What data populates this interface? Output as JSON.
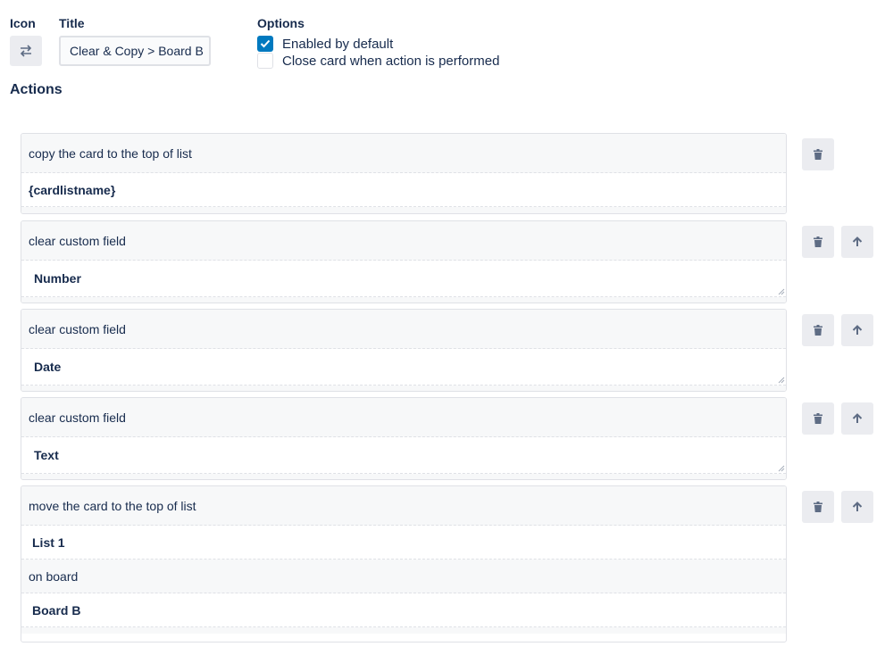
{
  "header": {
    "icon_label": "Icon",
    "title_label": "Title",
    "options_label": "Options",
    "title_value": "Clear & Copy > Board B",
    "icon_name": "swap-arrows-icon"
  },
  "options": [
    {
      "label": "Enabled by default",
      "checked": true
    },
    {
      "label": "Close card when action is performed",
      "checked": false
    }
  ],
  "actions_title": "Actions",
  "actions": [
    {
      "text": "copy the card to the top of list",
      "value": "{cardlistname}"
    },
    {
      "text": "clear custom field",
      "value": "Number"
    },
    {
      "text": "clear custom field",
      "value": "Date"
    },
    {
      "text": "clear custom field",
      "value": "Text"
    },
    {
      "text": "move the card to the top of list",
      "value": "List 1",
      "text2": "on board",
      "value2": "Board B"
    }
  ],
  "colors": {
    "accent": "#0079bf",
    "text": "#172b4d",
    "button_bg": "#ebecf0",
    "icon": "#5e6c84"
  }
}
